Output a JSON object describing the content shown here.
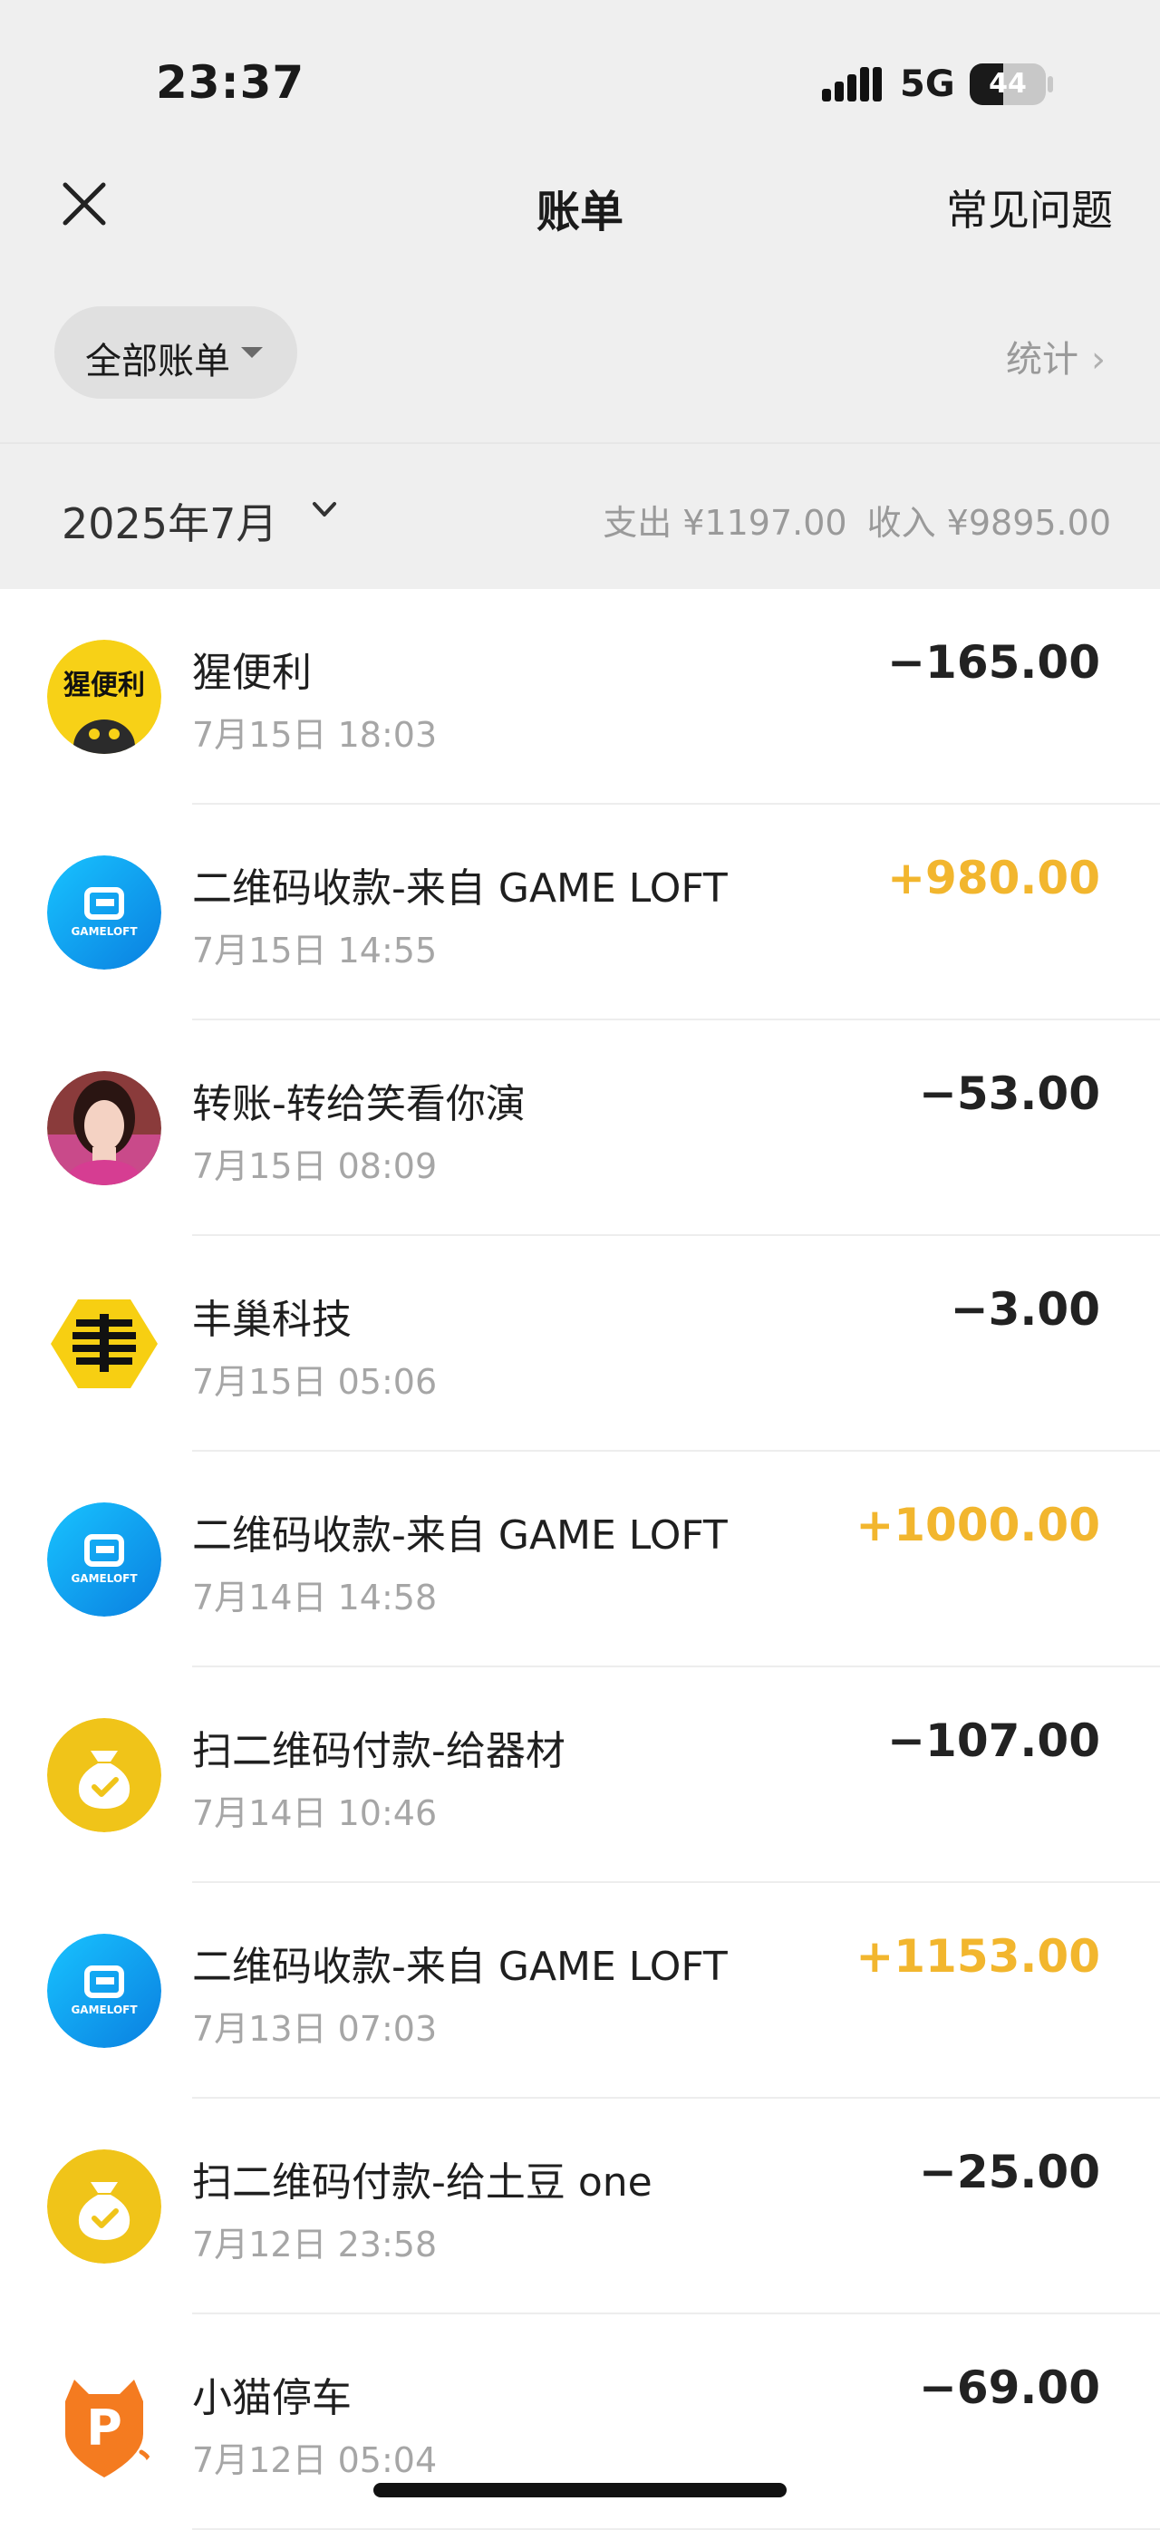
{
  "status": {
    "time": "23:37",
    "network": "5G",
    "battery": "44",
    "battery_level": 0.44
  },
  "nav": {
    "title": "账单",
    "faq_label": "常见问题"
  },
  "filter": {
    "label": "全部账单",
    "stats_label": "统计"
  },
  "month": {
    "label": "2025年7月",
    "expense": "支出 ¥1197.00",
    "income": "收入 ¥9895.00"
  },
  "transactions": [
    {
      "title": "猩便利",
      "time": "7月15日 18:03",
      "amount": "−165.00",
      "type": "expense",
      "icon": "xingbianli-logo",
      "logo_text": "猩便利"
    },
    {
      "title": "二维码收款-来自 GAME LOFT",
      "time": "7月15日 14:55",
      "amount": "+980.00",
      "type": "income",
      "icon": "gameloft-logo",
      "logo_text": "GAMELOFT"
    },
    {
      "title": "转账-转给笑看你演",
      "time": "7月15日 08:09",
      "amount": "−53.00",
      "type": "expense",
      "icon": "user-avatar"
    },
    {
      "title": "丰巢科技",
      "time": "7月15日 05:06",
      "amount": "−3.00",
      "type": "expense",
      "icon": "hive-box-logo"
    },
    {
      "title": "二维码收款-来自 GAME LOFT",
      "time": "7月14日 14:58",
      "amount": "+1000.00",
      "type": "income",
      "icon": "gameloft-logo",
      "logo_text": "GAMELOFT"
    },
    {
      "title": "扫二维码付款-给器材",
      "time": "7月14日 10:46",
      "amount": "−107.00",
      "type": "expense",
      "icon": "money-bag-icon"
    },
    {
      "title": "二维码收款-来自 GAME LOFT",
      "time": "7月13日 07:03",
      "amount": "+1153.00",
      "type": "income",
      "icon": "gameloft-logo",
      "logo_text": "GAMELOFT"
    },
    {
      "title": "扫二维码付款-给土豆 one",
      "time": "7月12日 23:58",
      "amount": "−25.00",
      "type": "expense",
      "icon": "money-bag-icon"
    },
    {
      "title": "小猫停车",
      "time": "7月12日 05:04",
      "amount": "−69.00",
      "type": "expense",
      "icon": "parking-logo",
      "logo_text": "P"
    }
  ],
  "colors": {
    "income": "#f2b62e",
    "expense": "#222222",
    "gameloft_blue": "#1aa6f0",
    "bag_yellow": "#f0c419",
    "parking_orange": "#f47b20"
  }
}
